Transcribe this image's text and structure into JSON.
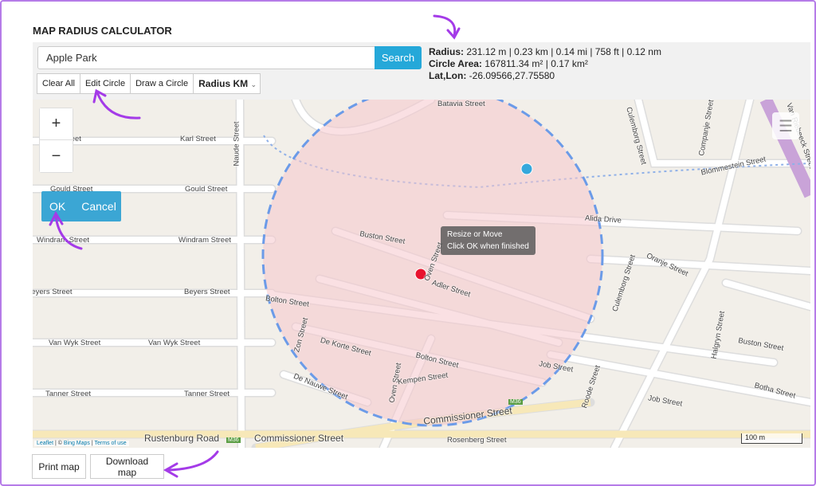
{
  "title": "MAP RADIUS CALCULATOR",
  "search": {
    "value": "Apple Park",
    "button": "Search"
  },
  "toolbar": {
    "clear": "Clear All",
    "edit": "Edit Circle",
    "draw": "Draw a Circle",
    "unit": "Radius KM"
  },
  "info": {
    "radius_label": "Radius:",
    "radius_value": "231.12 m | 0.23 km | 0.14 mi | 758 ft | 0.12 nm",
    "area_label": "Circle Area:",
    "area_value": "167811.34 m² | 0.17 km²",
    "latlon_label": "Lat,Lon:",
    "latlon_value": "-26.09566,27.75580"
  },
  "map": {
    "zoom_in": "+",
    "zoom_out": "−",
    "ok": "OK",
    "cancel": "Cancel",
    "tooltip_line1": "Resize or Move",
    "tooltip_line2": "Click OK when finished",
    "attribution": {
      "leaflet": "Leaflet",
      "sep1": " | © ",
      "bing": "Bing Maps",
      "sep2": " | ",
      "terms": "Terms of use"
    },
    "scale": "100 m",
    "circle_color": "#6b9be8",
    "fill_color": "#f5c6cc",
    "center_color": "#e8132e",
    "handle_color": "#35a8dc",
    "streets": [
      "Batavia Street",
      "Karl Street",
      "Karl Street",
      "Gould Street",
      "Gould Street",
      "Windram Street",
      "Windram Street",
      "Beyers Street",
      "Beyers Street",
      "Van Wyk Street",
      "Van Wyk Street",
      "Tanner Street",
      "Tanner Street",
      "Naude Street",
      "Buston Street",
      "Buston Street",
      "Adler Street",
      "Bolton Street",
      "Bolton Street",
      "De Korte Street",
      "Zon Street",
      "De Nauwe Street",
      "Oven Street",
      "Oven Street",
      "Kempen Street",
      "Commissioner Street",
      "Commissioner Street",
      "Rustenburg Road",
      "M36",
      "M36",
      "Alida Drive",
      "Oranje Street",
      "Culemborg Street",
      "Culemborg Street",
      "Blommestein Street",
      "Job Street",
      "Job Street",
      "Roode Street",
      "Halgryn Street",
      "Botha Street",
      "Rosenberg Street",
      "Van Riebeeck Street",
      "Companje Street"
    ]
  },
  "footer": {
    "print": "Print map",
    "download": "Download map"
  }
}
